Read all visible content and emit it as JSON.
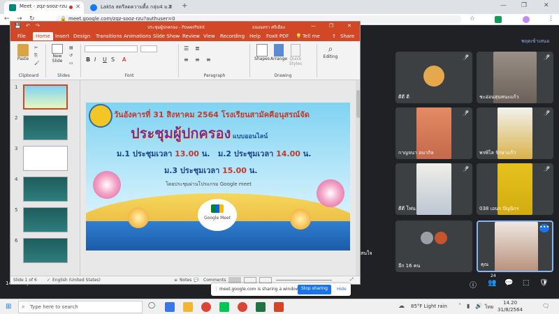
{
  "chrome": {
    "tabs": [
      {
        "title": "Meet - zqz-sooz-rzu",
        "active": true
      },
      {
        "title": "Lakta สตรีลดความดื้อ กลุ่ม4 ม.2",
        "active": false
      }
    ],
    "new_tab": "+",
    "url": "meet.google.com/zqz-sooz-rzu?authuser=0"
  },
  "meet": {
    "top_right_label": "พฤดเข้าเสนอ",
    "participants": [
      {
        "name": "ดีดี ดี"
      },
      {
        "name": "ชะอ่อนสุนทนะแก้ว"
      },
      {
        "name": "กาญจนา อนากิล"
      },
      {
        "name": "พรพิไล รักษาแก้ว"
      },
      {
        "name": "ดีดี โฟน"
      },
      {
        "name": "038 เอนก ปัญนิกร"
      },
      {
        "name": "อีก 16 คน"
      },
      {
        "name": "คุณ"
      }
    ],
    "side_label": "สนใจ",
    "meeting_time": "14:20",
    "meeting_code": "zqz-sooz-rzu",
    "people_count": "24",
    "share_notice": "meet.google.com is sharing a window.",
    "stop_sharing": "Stop sharing",
    "hide": "Hide"
  },
  "ppt": {
    "doc_title": "ประชุมผู้ปกครอง - PowerPoint",
    "user": "ธณณทรา ศรีเมือง",
    "menu": [
      "File",
      "Home",
      "Insert",
      "Design",
      "Transitions",
      "Animations",
      "Slide Show",
      "Review",
      "View",
      "Recording",
      "Help",
      "Foxit PDF",
      "Tell me",
      "Share"
    ],
    "ribbon": {
      "paste": "Paste",
      "new_slide": "New Slide",
      "shapes": "Shapes",
      "arrange": "Arrange",
      "quick_styles": "Quick Styles",
      "editing": "Editing",
      "groups": [
        "Clipboard",
        "Slides",
        "Font",
        "Paragraph",
        "Drawing"
      ]
    },
    "slide_numbers": [
      "1",
      "2",
      "3",
      "4",
      "5",
      "6"
    ],
    "slide": {
      "line1": "วันอังคารที่ 31 สิงหาคม 2564 โรงเรียนสามัคคีอนุสรณ์จัด",
      "line2": "ประชุมผู้ปกครอง",
      "line2_suffix": "แบบออนไลน์",
      "line3a": "ม.1 ประชุมเวลา ",
      "line3a_time": "13.00",
      "line3a_end": " น.",
      "line3b": "ม.2 ประชุมเวลา ",
      "line3b_time": "14.00",
      "line3b_end": " น.",
      "line4": "ม.3 ประชุมเวลา ",
      "line4_time": "15.00",
      "line4_end": " น.",
      "line5": "โดยประชุมผ่านโปรแกรม Google meet",
      "logo_label": "Google Meet"
    },
    "status": {
      "slide_of": "Slide 1 of 6",
      "language": "English (United States)",
      "notes": "Notes",
      "comments": "Comments"
    }
  },
  "taskbar": {
    "search": "Type here to search",
    "weather": "85°F Light rain",
    "lang": "ไทย",
    "time": "14.20",
    "date": "31/8/2564"
  },
  "colors": {
    "ppt_red": "#d24726",
    "meet_bg": "#202124",
    "accent": "#1a73e8"
  }
}
